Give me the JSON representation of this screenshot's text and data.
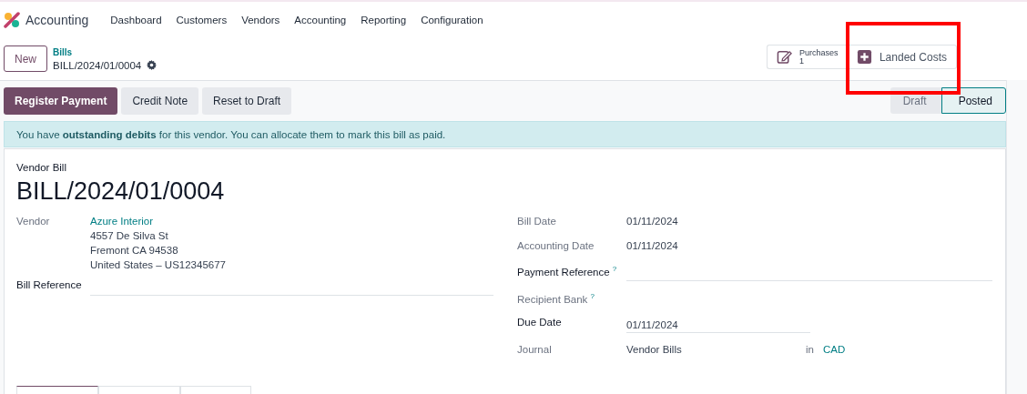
{
  "app": {
    "name": "Accounting"
  },
  "menu": [
    {
      "label": "Dashboard"
    },
    {
      "label": "Customers"
    },
    {
      "label": "Vendors"
    },
    {
      "label": "Accounting"
    },
    {
      "label": "Reporting"
    },
    {
      "label": "Configuration"
    }
  ],
  "control_panel": {
    "new_button": "New",
    "breadcrumb": "Bills",
    "record": "BILL/2024/01/0004"
  },
  "smart_buttons": [
    {
      "kind": "stat",
      "label": "Purchases",
      "value": "1",
      "highlighted": false
    },
    {
      "kind": "action",
      "label": "Landed Costs",
      "highlighted": true
    }
  ],
  "actions": [
    {
      "label": "Register Payment",
      "primary": true
    },
    {
      "label": "Credit Note",
      "primary": false
    },
    {
      "label": "Reset to Draft",
      "primary": false
    }
  ],
  "statusbar": [
    {
      "label": "Draft",
      "selected": false
    },
    {
      "label": "Posted",
      "selected": true
    }
  ],
  "alert": "You have **outstanding debits** for this vendor. You can allocate them to mark this bill as paid.",
  "form": {
    "type_label": "Vendor Bill",
    "title": "BILL/2024/01/0004",
    "left_fields": [
      {
        "kind": "partner",
        "label": "Vendor",
        "required": false,
        "value": "Azure Interior",
        "address": [
          "4557 De Silva St",
          "Fremont CA 94538",
          "United States – US12345677"
        ]
      },
      {
        "kind": "input",
        "label": "Bill Reference",
        "required": true,
        "short": false
      }
    ],
    "right_fields": [
      {
        "kind": "text",
        "label": "Bill Date",
        "required": false,
        "value": "01/11/2024"
      },
      {
        "kind": "text",
        "label": "Accounting Date",
        "required": false,
        "value": "01/11/2024"
      },
      {
        "kind": "input",
        "label": "Payment Reference $^{?}$",
        "required": true,
        "short": false
      },
      {
        "kind": "text",
        "label": "Recipient Bank $^{?}$",
        "required": false
      },
      {
        "kind": "input",
        "label": "Due Date",
        "required": true,
        "short": true,
        "value": "01/11/2024"
      },
      {
        "kind": "journal",
        "label": "Journal",
        "required": false,
        "value": "Vendor Bills",
        "joiner": "in",
        "currency": "CAD"
      }
    ],
    "tabs": [
      {
        "selected": true
      },
      {
        "selected": false
      },
      {
        "selected": false
      }
    ]
  }
}
